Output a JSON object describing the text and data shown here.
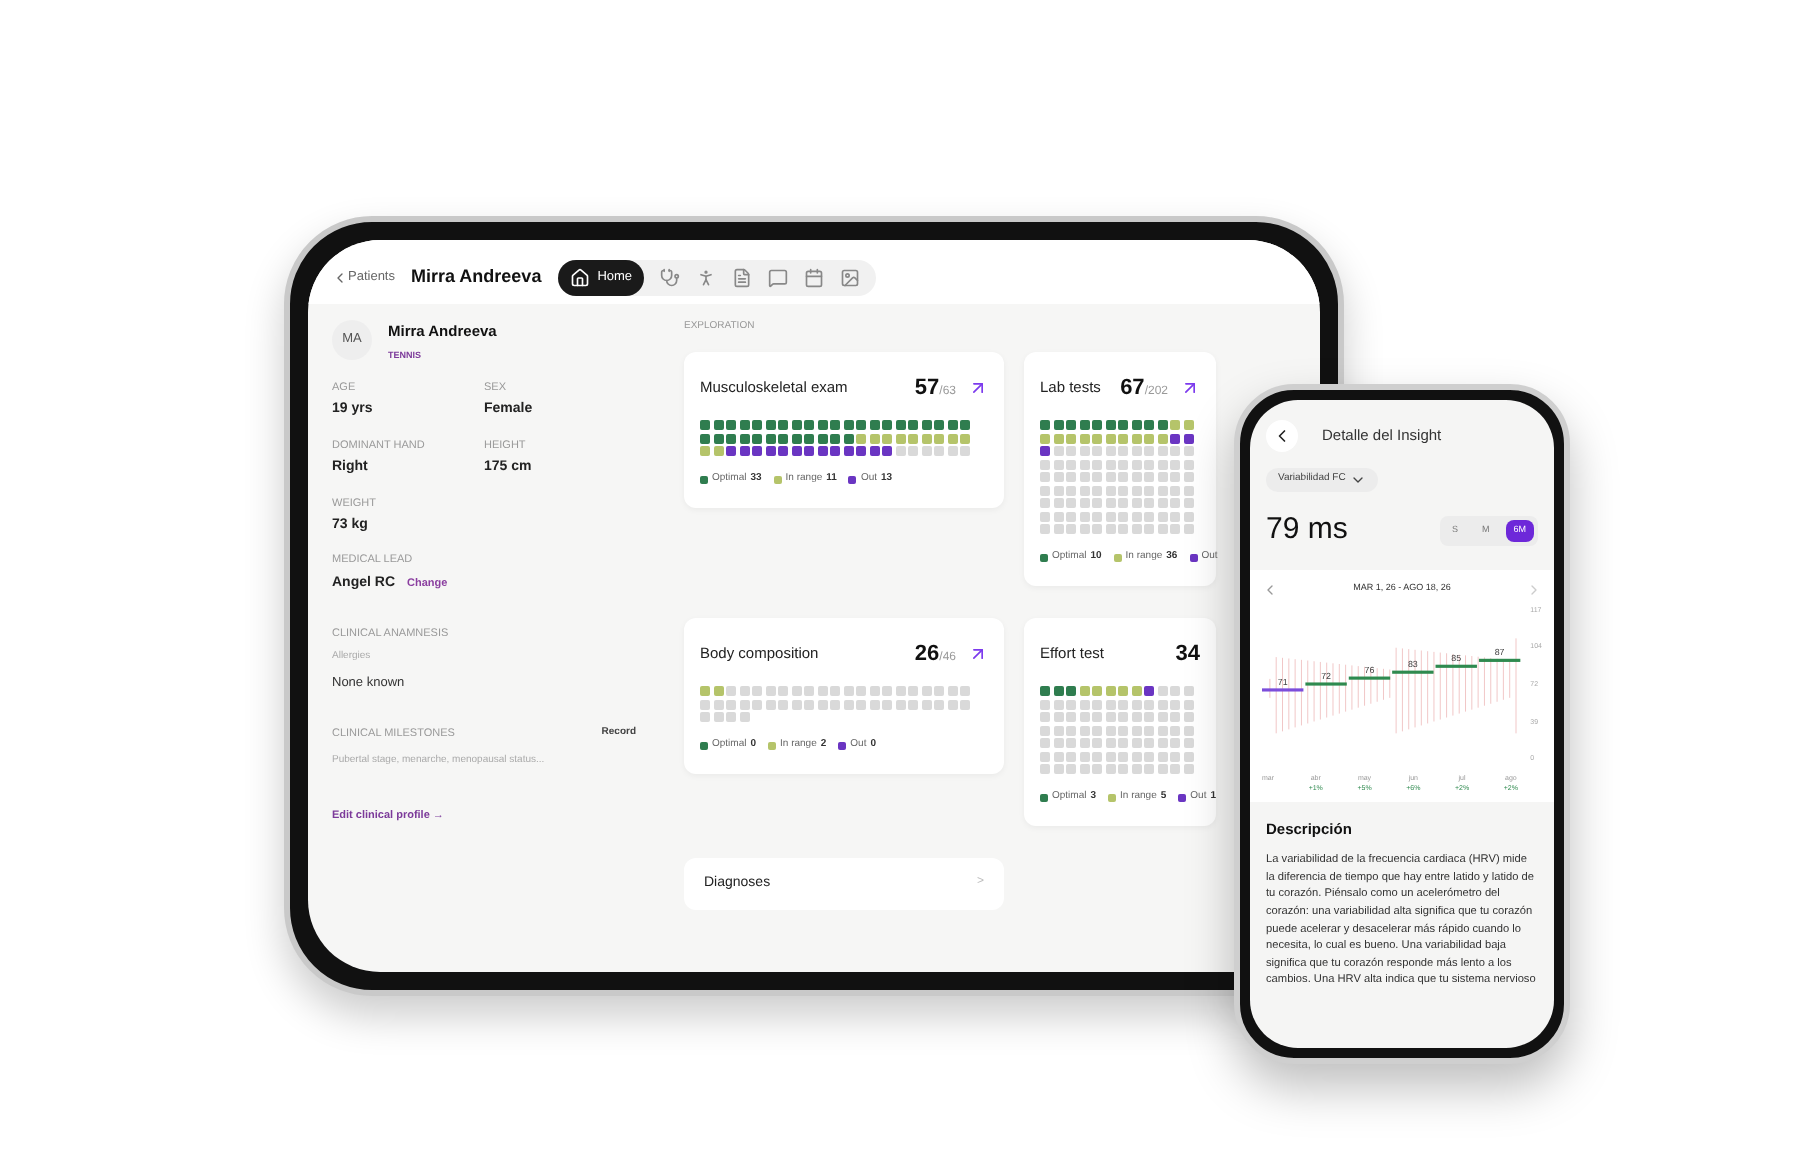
{
  "tablet": {
    "breadcrumb": "Patients",
    "patient_name": "Mirra Andreeva",
    "tabs": [
      {
        "label": "Home",
        "selected": true
      },
      {
        "selected": false
      },
      {
        "selected": false
      },
      {
        "selected": false
      },
      {
        "selected": false
      },
      {
        "selected": false
      },
      {
        "selected": false
      }
    ],
    "profile": {
      "initials": "MA",
      "name": "Mirra Andreeva",
      "sport": "TENNIS",
      "fields": [
        {
          "label": "AGE",
          "value": "19 yrs"
        },
        {
          "label": "SEX",
          "value": "Female"
        },
        {
          "label": "DOMINANT HAND",
          "value": "Right"
        },
        {
          "label": "HEIGHT",
          "value": "175 cm"
        },
        {
          "label": "WEIGHT",
          "value": "73 kg"
        }
      ],
      "medical_lead": {
        "label": "MEDICAL LEAD",
        "value": "Angel RC",
        "action": "Change"
      },
      "anamnesis": {
        "title": "CLINICAL ANAMNESIS",
        "label": "Allergies",
        "value": "None known"
      },
      "milestones": {
        "title": "CLINICAL MILESTONES",
        "action": "Record",
        "placeholder": "Pubertal stage, menarche, menopausal status..."
      },
      "edit_link": "Edit clinical profile →"
    },
    "section_title": "EXPLORATION",
    "cards": [
      {
        "title": "Musculoskeletal exam",
        "score": "57",
        "total": "/63",
        "legend": [
          {
            "label": "Optimal",
            "count": "33",
            "color": "#2f7d4f"
          },
          {
            "label": "In range",
            "count": "11",
            "color": "#b5c46a"
          },
          {
            "label": "Out",
            "count": "13",
            "color": "#6a35c2"
          }
        ]
      },
      {
        "title": "Lab tests",
        "score": "67",
        "total": "/202",
        "legend": [
          {
            "label": "Optimal",
            "count": "10",
            "color": "#2f7d4f"
          },
          {
            "label": "In range",
            "count": "36",
            "color": "#b5c46a"
          },
          {
            "label": "Out",
            "color": "#6a35c2"
          }
        ]
      },
      {
        "title": "Body composition",
        "score": "26",
        "total": "/46",
        "legend": [
          {
            "label": "Optimal",
            "count": "0",
            "color": "#2f7d4f"
          },
          {
            "label": "In range",
            "count": "2",
            "color": "#b5c46a"
          },
          {
            "label": "Out",
            "count": "0",
            "color": "#6a35c2"
          }
        ]
      },
      {
        "title": "Effort test",
        "score": "34",
        "legend": [
          {
            "label": "Optimal",
            "count": "3",
            "color": "#2f7d4f"
          },
          {
            "label": "In range",
            "count": "5",
            "color": "#b5c46a"
          },
          {
            "label": "Out",
            "count": "1",
            "color": "#6a35c2"
          }
        ]
      }
    ],
    "diagnoses": {
      "title": "Diagnoses",
      "chevron": ">"
    }
  },
  "phone": {
    "title": "Detalle del Insight",
    "metric": "Variabilidad FC",
    "value": "79 ms",
    "ranges": [
      {
        "label": "S",
        "selected": false
      },
      {
        "label": "M",
        "selected": false
      },
      {
        "label": "6M",
        "selected": true
      }
    ],
    "date_range": "MAR 1, 26 - AGO 18, 26",
    "y_ticks": [
      "117",
      "104",
      "72",
      "39",
      "0"
    ],
    "segments": [
      {
        "label": "71",
        "color": "#7c4ddb"
      },
      {
        "label": "72",
        "color": "#2f8a4f"
      },
      {
        "label": "76",
        "color": "#2f8a4f"
      },
      {
        "label": "83",
        "color": "#2f8a4f"
      },
      {
        "label": "85",
        "color": "#2f8a4f"
      },
      {
        "label": "87",
        "color": "#2f8a4f"
      }
    ],
    "months": [
      {
        "label": "mar"
      },
      {
        "label": "abr",
        "delta": "+1%"
      },
      {
        "label": "may",
        "delta": "+5%"
      },
      {
        "label": "jun",
        "delta": "+6%"
      },
      {
        "label": "jul",
        "delta": "+2%"
      },
      {
        "label": "ago",
        "delta": "+2%"
      }
    ],
    "description_title": "Descripción",
    "description": "La variabilidad de la frecuencia cardiaca (HRV) mide la diferencia de tiempo que hay entre latido y latido de tu corazón. Piénsalo como un acelerómetro del corazón: una variabilidad alta significa que tu corazón puede acelerar y desacelerar más rápido cuando lo necesita, lo cual es bueno. Una variabilidad baja significa que tu corazón responde más lento a los cambios. Una HRV alta indica que tu sistema nervioso"
  }
}
